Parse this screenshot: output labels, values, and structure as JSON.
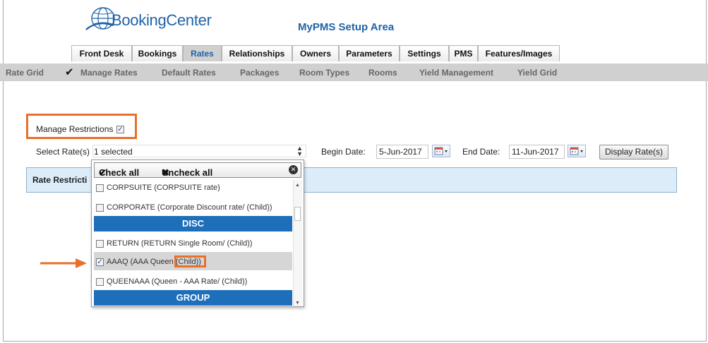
{
  "header": {
    "logo_text": "BookingCenter",
    "setup_title": "MyPMS Setup Area"
  },
  "tabs": [
    {
      "label": "Front Desk",
      "active": false
    },
    {
      "label": "Bookings",
      "active": false
    },
    {
      "label": "Rates",
      "active": true
    },
    {
      "label": "Relationships",
      "active": false
    },
    {
      "label": "Owners",
      "active": false
    },
    {
      "label": "Parameters",
      "active": false
    },
    {
      "label": "Settings",
      "active": false
    },
    {
      "label": "PMS",
      "active": false
    },
    {
      "label": "Features/Images",
      "active": false
    }
  ],
  "subnav": [
    {
      "label": "Rate Grid"
    },
    {
      "label": "Manage Rates",
      "checked": true
    },
    {
      "label": "Default Rates"
    },
    {
      "label": "Packages"
    },
    {
      "label": "Room Types"
    },
    {
      "label": "Rooms"
    },
    {
      "label": "Yield Management"
    },
    {
      "label": "Yield Grid"
    }
  ],
  "form": {
    "manage_restrictions_label": "Manage Restrictions",
    "manage_restrictions_checked": true,
    "select_rates_label": "Select Rate(s)",
    "select_rates_value": "1 selected",
    "begin_date_label": "Begin Date:",
    "begin_date_value": "5-Jun-2017",
    "end_date_label": "End Date:",
    "end_date_value": "11-Jun-2017",
    "display_button": "Display Rate(s)"
  },
  "restrictions_panel": {
    "title": "Rate Restricti"
  },
  "dropdown": {
    "check_all": "Check all",
    "uncheck_all": "Uncheck all",
    "options": [
      {
        "label": "CORPSUITE (CORPSUITE rate)",
        "checked": false
      },
      {
        "label": "CORPORATE (Corporate Discount rate/ (Child))",
        "checked": false
      },
      {
        "group": "DISC"
      },
      {
        "label": "RETURN (RETURN Single Room/ (Child))",
        "checked": false
      },
      {
        "label": "AAAQ (AAA Queen",
        "label_suffix": "(Child))",
        "checked": true
      },
      {
        "label": "QUEENAAA (Queen - AAA Rate/ (Child))",
        "checked": false
      },
      {
        "group": "GROUP"
      }
    ]
  },
  "colors": {
    "accent_blue": "#1f63a8",
    "group_blue": "#1e6fb9",
    "highlight_orange": "#e8702a",
    "subnav_gray": "#d0d0d0",
    "panel_blue": "#dcecf9"
  }
}
